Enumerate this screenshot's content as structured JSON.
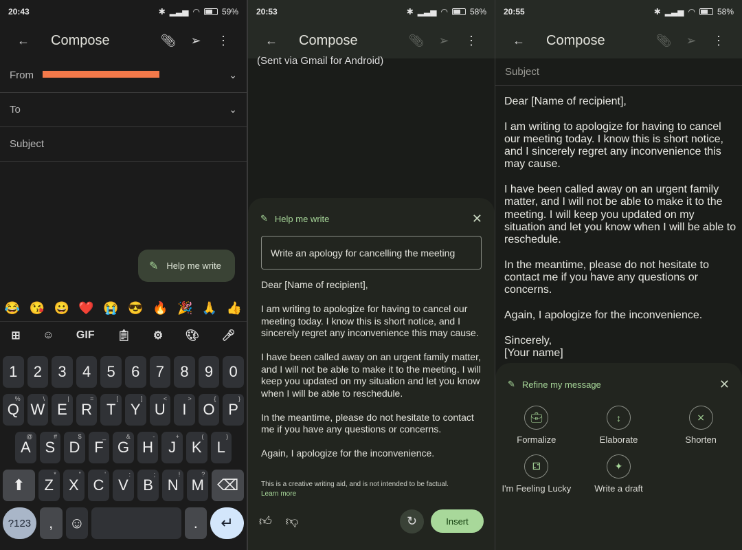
{
  "panel1": {
    "status": {
      "time": "20:43",
      "battery": "59%",
      "battery_level": 59
    },
    "header": {
      "title": "Compose"
    },
    "from_label": "From",
    "to_label": "To",
    "subject_placeholder": "Subject",
    "help_chip": "Help me write",
    "emojis": [
      "😂",
      "😘",
      "😀",
      "❤️",
      "😭",
      "😎",
      "🔥",
      "🎉",
      "🙏",
      "👍"
    ],
    "keyboard": {
      "numbers": [
        "1",
        "2",
        "3",
        "4",
        "5",
        "6",
        "7",
        "8",
        "9",
        "0"
      ],
      "row1": [
        [
          "Q",
          "%"
        ],
        [
          "W",
          "\\"
        ],
        [
          "E",
          "|"
        ],
        [
          "R",
          "="
        ],
        [
          "T",
          "["
        ],
        [
          "Y",
          "]"
        ],
        [
          "U",
          "<"
        ],
        [
          "I",
          ">"
        ],
        [
          "O",
          "{"
        ],
        [
          "P",
          "}"
        ]
      ],
      "row2": [
        [
          "A",
          "@"
        ],
        [
          "S",
          "#"
        ],
        [
          "D",
          "$"
        ],
        [
          "F",
          "_"
        ],
        [
          "G",
          "&"
        ],
        [
          "H",
          "-"
        ],
        [
          "J",
          "+"
        ],
        [
          "K",
          "("
        ],
        [
          "L",
          ")"
        ]
      ],
      "row3": [
        [
          "Z",
          "*"
        ],
        [
          "X",
          "\""
        ],
        [
          "C",
          "'"
        ],
        [
          "V",
          ":"
        ],
        [
          "B",
          ";"
        ],
        [
          "N",
          "!"
        ],
        [
          "M",
          "?"
        ]
      ],
      "symbols": "?123",
      "comma": ",",
      "period": ".",
      "gif": "GIF"
    }
  },
  "panel2": {
    "status": {
      "time": "20:53",
      "battery": "58%",
      "battery_level": 58
    },
    "header": {
      "title": "Compose"
    },
    "sent_via": "(Sent via Gmail for Android)",
    "sheet": {
      "title": "Help me write",
      "prompt": "Write an apology for cancelling the meeting",
      "paragraphs": [
        "Dear [Name of recipient],",
        "I am writing to apologize for having to cancel our meeting today. I know this is short notice, and I sincerely regret any inconvenience this may cause.",
        "I have been called away on an urgent family matter, and I will not be able to make it to the meeting. I will keep you updated on my situation and let you know when I will be able to reschedule.",
        "In the meantime, please do not hesitate to contact me if you have any questions or concerns.",
        "Again, I apologize for the inconvenience."
      ],
      "disclaimer": "This is a creative writing aid, and is not intended to be factual.",
      "learn_more": "Learn more",
      "insert": "Insert"
    }
  },
  "panel3": {
    "status": {
      "time": "20:55",
      "battery": "58%",
      "battery_level": 58
    },
    "header": {
      "title": "Compose"
    },
    "subject_placeholder": "Subject",
    "paragraphs": [
      "Dear [Name of recipient],",
      "I am writing to apologize for having to cancel our meeting today. I know this is short notice, and I sincerely regret any inconvenience this may cause.",
      "I have been called away on an urgent family matter, and I will not be able to make it to the meeting. I will keep you updated on my situation and let you know when I will be able to reschedule.",
      "In the meantime, please do not hesitate to contact me if you have any questions or concerns.",
      "Again, I apologize for the inconvenience.",
      "Sincerely,\n[Your name]"
    ],
    "sheet": {
      "title": "Refine my message",
      "options": [
        {
          "label": "Formalize",
          "icon": "briefcase-icon"
        },
        {
          "label": "Elaborate",
          "icon": "expand-icon"
        },
        {
          "label": "Shorten",
          "icon": "collapse-icon"
        },
        {
          "label": "I'm Feeling Lucky",
          "icon": "dice-icon"
        },
        {
          "label": "Write a draft",
          "icon": "sparkle-icon"
        }
      ]
    }
  },
  "colors": {
    "accent": "#a8d89a",
    "redaction": "#f4794a"
  }
}
